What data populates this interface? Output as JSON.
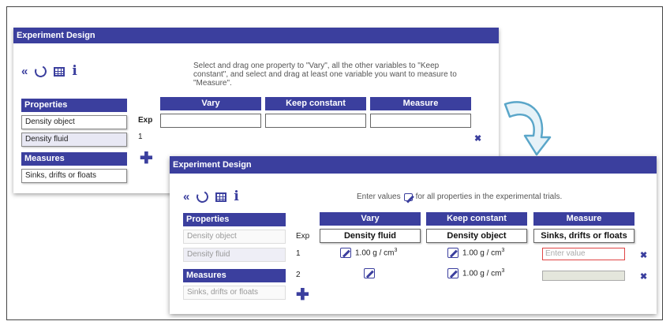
{
  "panel_back": {
    "title": "Experiment Design",
    "toolbar": {
      "collapse_icon": "«",
      "info_icon": "i"
    },
    "instruction": "Select and drag one property to \"Vary\", all the other variables to \"Keep constant\", and select and drag at least one variable you want to measure to \"Measure\".",
    "properties_header": "Properties",
    "properties": [
      "Density object",
      "Density fluid"
    ],
    "measures_header": "Measures",
    "measures": [
      "Sinks, drifts or floats"
    ],
    "columns": [
      "Vary",
      "Keep constant",
      "Measure"
    ],
    "exp_label": "Exp",
    "rows": [
      {
        "num": "1"
      }
    ]
  },
  "panel_front": {
    "title": "Experiment Design",
    "toolbar": {
      "collapse_icon": "«",
      "info_icon": "i"
    },
    "instruction": "Enter values",
    "instruction_suffix": "for all properties in the experimental trials.",
    "properties_header": "Properties",
    "properties": [
      "Density object",
      "Density fluid"
    ],
    "measures_header": "Measures",
    "measures": [
      "Sinks, drifts or floats"
    ],
    "columns": [
      "Vary",
      "Keep constant",
      "Measure"
    ],
    "assigned": [
      "Density fluid",
      "Density object",
      "Sinks, drifts or floats"
    ],
    "exp_label": "Exp",
    "rows": [
      {
        "num": "1",
        "vary_value": "1.00 g / cm",
        "keep_value": "1.00 g / cm",
        "unit_sup": "3",
        "measure_placeholder": "Enter value"
      },
      {
        "num": "2",
        "vary_value": "",
        "keep_value": "1.00 g / cm",
        "unit_sup": "3"
      }
    ]
  },
  "colors": {
    "accent": "#3b3f9e",
    "error_border": "#e04545",
    "arrow": "#5aa6c9"
  },
  "icons": [
    "collapse-icon",
    "reset-icon",
    "table-icon",
    "info-icon",
    "edit-icon",
    "delete-icon",
    "add-icon",
    "curved-arrow-icon"
  ]
}
